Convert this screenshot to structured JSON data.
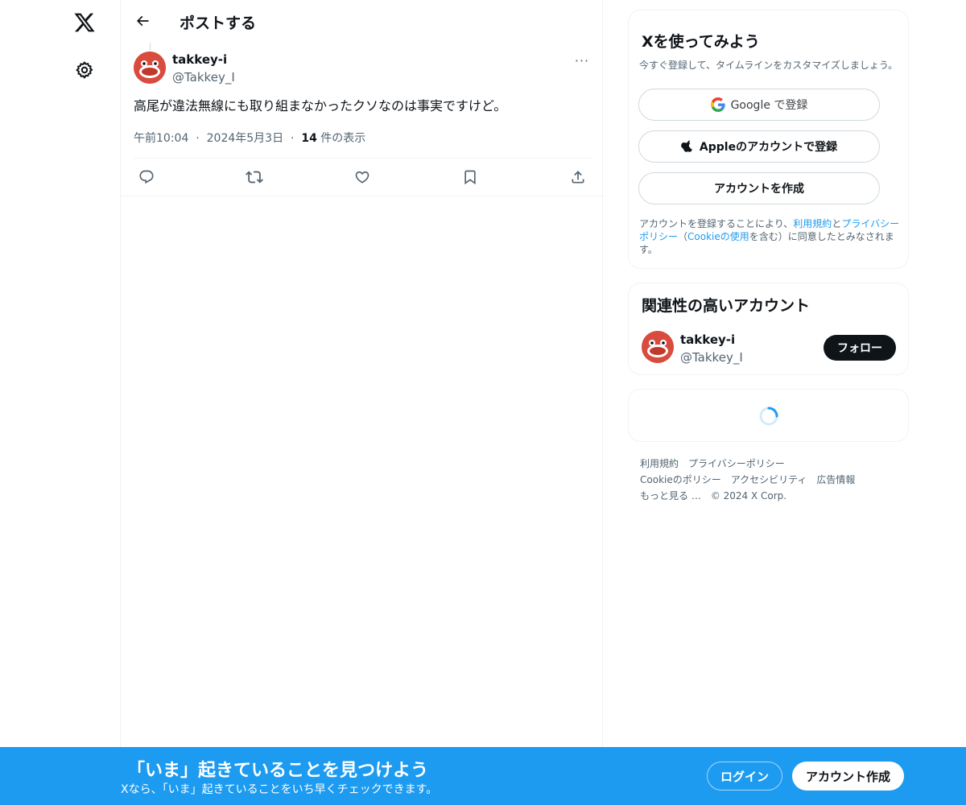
{
  "nav": {
    "logo_icon": "x-logo-icon",
    "settings_icon": "gear-icon"
  },
  "header": {
    "back_icon": "arrow-left-icon",
    "title": "ポストする"
  },
  "post": {
    "author": {
      "display_name": "takkey-i",
      "handle": "@Takkey_I",
      "avatar_color": "#d94b3e"
    },
    "more_icon": "more-horizontal-icon",
    "more_label": "···",
    "text": "高尾が違法無線にも取り組まなかったクソなのは事実ですけど。",
    "time": "午前10:04",
    "sep1": "·",
    "date": "2024年5月3日",
    "sep2": "·",
    "views_count": "14",
    "views_label": " 件の表示",
    "actions": [
      "reply-icon",
      "repost-icon",
      "like-icon",
      "bookmark-icon",
      "share-icon"
    ]
  },
  "signup": {
    "title": "Xを使ってみよう",
    "subtitle": "今すぐ登録して、タイムラインをカスタマイズしましょう。",
    "google_label": "Google で登録",
    "apple_label": "Appleのアカウントで登録",
    "create_label": "アカウントを作成",
    "terms_prefix": "アカウントを登録することにより、",
    "terms_link": "利用規約",
    "terms_and": "と",
    "privacy_link": "プライバシーポリシー",
    "terms_paren_open": "（",
    "cookie_link": "Cookieの使用",
    "terms_suffix": "を含む）に同意したとみなされます。"
  },
  "related": {
    "title": "関連性の高いアカウント",
    "account": {
      "display_name": "takkey-i",
      "handle": "@Takkey_I"
    },
    "follow_label": "フォロー"
  },
  "footer": {
    "links": [
      "利用規約",
      "プライバシーポリシー",
      "Cookieのポリシー",
      "アクセシビリティ",
      "広告情報",
      "もっと見る …"
    ],
    "copyright": "© 2024 X Corp."
  },
  "banner": {
    "title": "「いま」起きていることを見つけよう",
    "subtitle": "Xなら、「いま」起きていることをいち早くチェックできます。",
    "login_label": "ログイン",
    "create_label": "アカウント作成",
    "bg_color": "#1d9bf0"
  }
}
